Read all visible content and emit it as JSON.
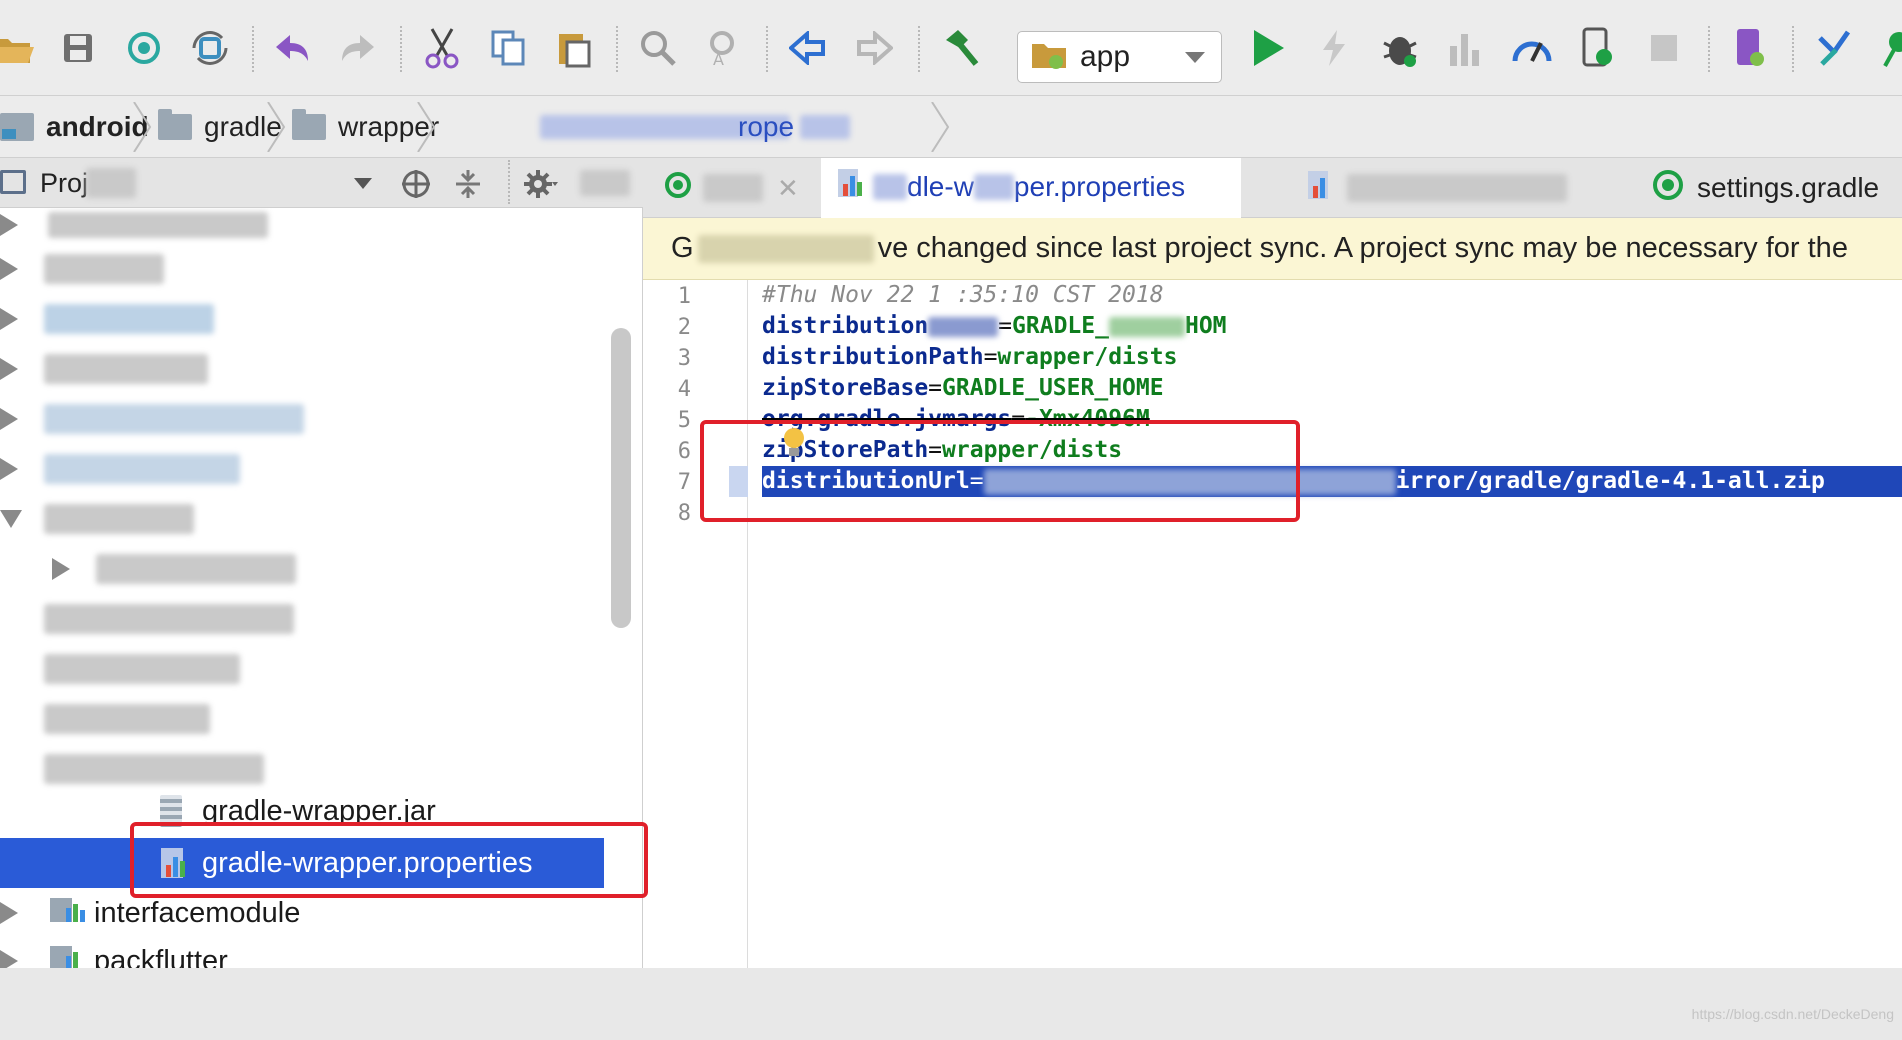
{
  "toolbar": {
    "run_config": "app",
    "icons": [
      "open-folder-icon",
      "save-icon",
      "sync-icon",
      "refresh-icon",
      "undo-icon",
      "redo-icon",
      "cut-icon",
      "copy-icon",
      "paste-icon",
      "find-icon",
      "replace-icon",
      "back-icon",
      "forward-icon",
      "build-icon",
      "run-icon",
      "apply-changes-icon",
      "debug-icon",
      "coverage-icon",
      "profile-icon",
      "attach-debugger-icon",
      "stop-icon",
      "avd-manager-icon",
      "vcs-icon"
    ],
    "colors": {
      "run": "#1ea045",
      "debug": "#3a3a3a",
      "back": "#2d6fd1",
      "undo": "#8a56c4",
      "build": "#2a8a3a"
    }
  },
  "breadcrumb": {
    "items": [
      "android",
      "gradle",
      "wrapper",
      "rope"
    ]
  },
  "project_panel": {
    "title": "Proj",
    "tree": {
      "jar_file": "gradle-wrapper.jar",
      "selected_file": "gradle-wrapper.properties",
      "module_1": "interfacemodule",
      "module_2": "packflutter"
    }
  },
  "editor": {
    "tabs": [
      {
        "label": "dle-w",
        "label_b": "per.properties",
        "active": true
      },
      {
        "label": "settings.gradle",
        "active": false
      }
    ],
    "banner": "ve changed since last project sync. A project sync may be necessary for the",
    "banner_prefix": "G",
    "line_numbers": [
      "1",
      "2",
      "3",
      "4",
      "5",
      "6",
      "7",
      "8"
    ],
    "lines": [
      {
        "comment": "#Thu Nov 22 1 :35:10 CST 2018"
      },
      {
        "key": "distribution",
        "eq": "=",
        "val": "GRADLE_",
        "val_b": "HOM"
      },
      {
        "key": "distributionPath",
        "eq": "=",
        "val": "wrapper/dists"
      },
      {
        "key": "zipStoreBase",
        "eq": "=",
        "val": "GRADLE_USER_HOME"
      },
      {
        "key": "org.gradle.jvmargs",
        "eq": "=",
        "val": "-Xmx4096M"
      },
      {
        "key": "zipStorePath",
        "eq": "=",
        "val": "wrapper/dists"
      },
      {
        "key": "distributionUrl",
        "eq": "=",
        "val": "irror/gradle/gradle-4.1-all.zip"
      }
    ]
  },
  "watermark": "https://blog.csdn.net/DeckeDeng",
  "colors": {
    "selection": "#2a5bd7",
    "highlight_box": "#e0202a",
    "banner_bg": "#fbf6d4",
    "key": "#0b2a8f",
    "value": "#0f7d1e"
  }
}
